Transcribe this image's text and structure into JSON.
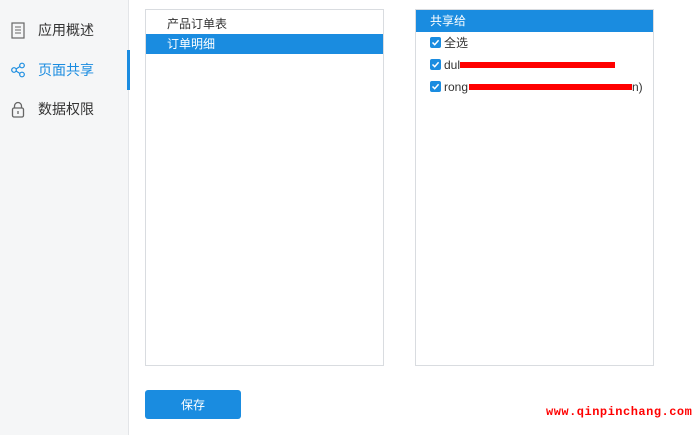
{
  "sidebar": {
    "items": [
      {
        "label": "应用概述",
        "icon": "document-icon",
        "active": false
      },
      {
        "label": "页面共享",
        "icon": "share-icon",
        "active": true
      },
      {
        "label": "数据权限",
        "icon": "lock-icon",
        "active": false
      }
    ]
  },
  "pages": {
    "items": [
      {
        "label": "产品订单表",
        "selected": false
      },
      {
        "label": "订单明细",
        "selected": true
      }
    ]
  },
  "share": {
    "header": "共享给",
    "select_all": {
      "label": "全选",
      "checked": true
    },
    "users": [
      {
        "label_visible_start": "dul",
        "label_visible_end": "",
        "checked": true
      },
      {
        "label_visible_start": "rong",
        "label_visible_end": "n)",
        "checked": true
      }
    ]
  },
  "actions": {
    "save_label": "保存"
  },
  "watermark": "www.qinpinchang.com",
  "colors": {
    "accent": "#1a8ce0",
    "redaction": "#ff0000",
    "sidebar_bg": "#f5f6f7"
  }
}
